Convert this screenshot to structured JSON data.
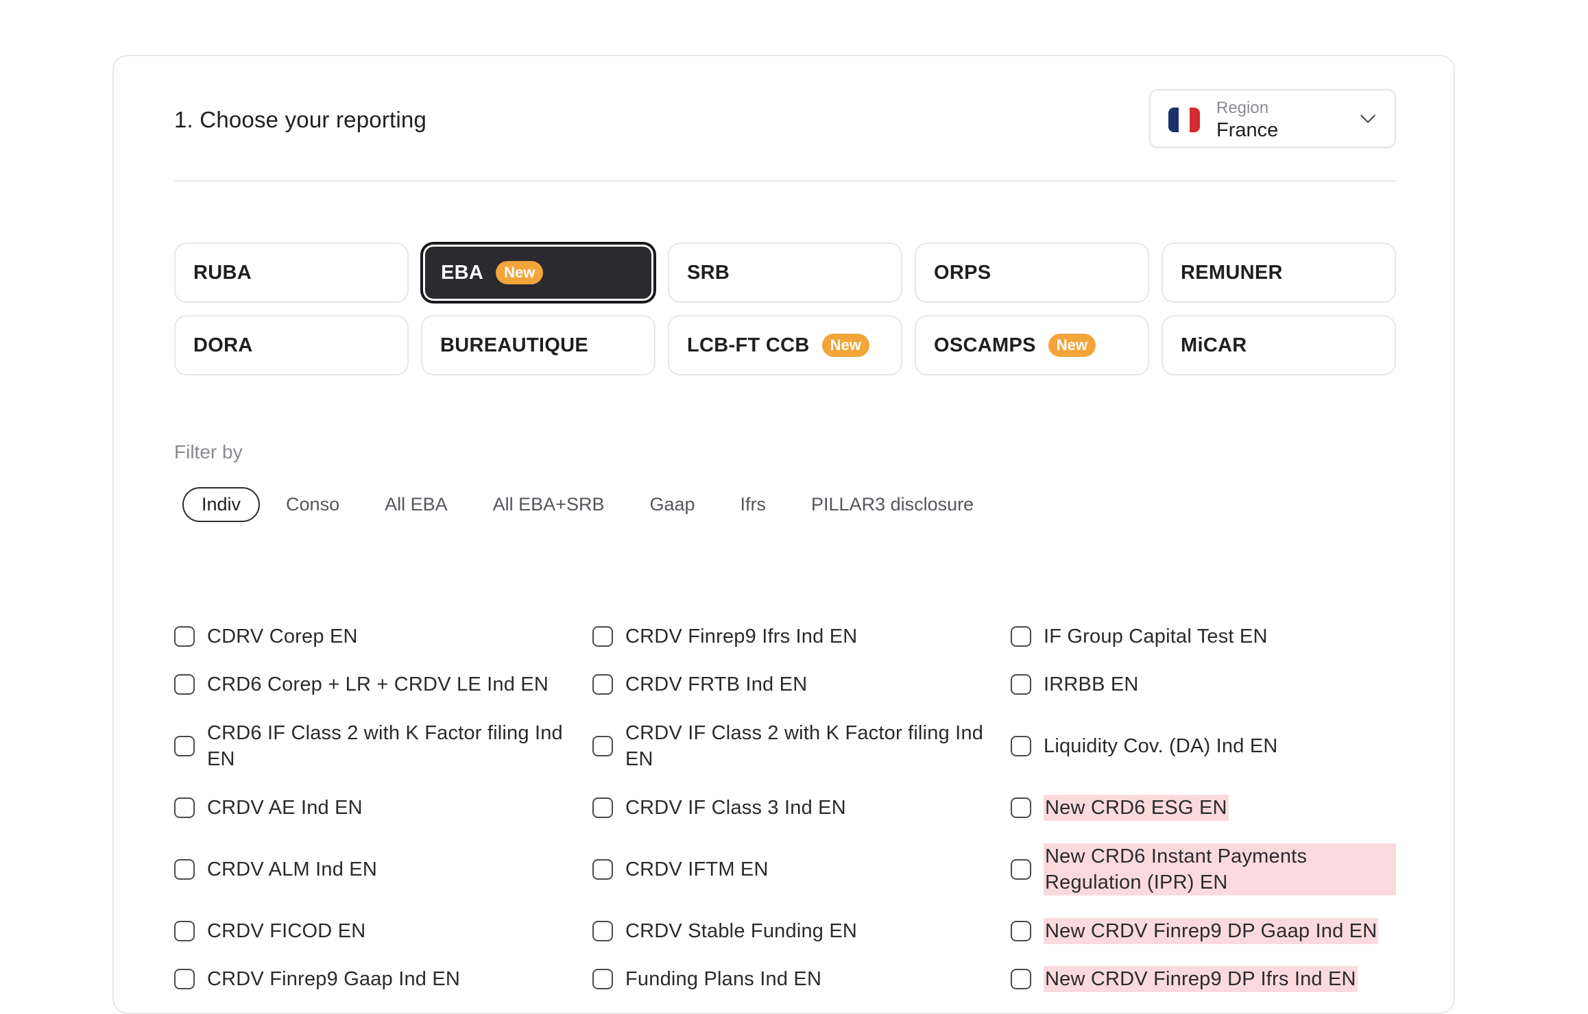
{
  "header": {
    "title": "1. Choose your reporting",
    "region": {
      "label": "Region",
      "value": "France",
      "flag_colors": [
        "#1f2f6b",
        "#ffffff",
        "#d52b2b"
      ]
    }
  },
  "tiles": [
    {
      "label": "RUBA",
      "badge": ""
    },
    {
      "label": "EBA",
      "badge": "New",
      "selected": true
    },
    {
      "label": "SRB",
      "badge": ""
    },
    {
      "label": "ORPS",
      "badge": ""
    },
    {
      "label": "REMUNER",
      "badge": ""
    },
    {
      "label": "DORA",
      "badge": ""
    },
    {
      "label": "BUREAUTIQUE",
      "badge": ""
    },
    {
      "label": "LCB-FT CCB",
      "badge": "New"
    },
    {
      "label": "OSCAMPS",
      "badge": "New"
    },
    {
      "label": "MiCAR",
      "badge": ""
    }
  ],
  "filter": {
    "label": "Filter by",
    "chips": [
      "Indiv",
      "Conso",
      "All EBA",
      "All EBA+SRB",
      "Gaap",
      "Ifrs",
      "PILLAR3 disclosure"
    ],
    "active": "Indiv"
  },
  "options": {
    "col1": [
      "CDRV Corep EN",
      "CRD6 Corep + LR + CRDV LE Ind EN",
      "CRD6 IF Class 2 with K Factor filing Ind EN",
      "CRDV AE Ind EN",
      "CRDV ALM Ind EN",
      "CRDV FICOD EN",
      "CRDV Finrep9 Gaap Ind EN"
    ],
    "col2": [
      "CRDV Finrep9 Ifrs Ind EN",
      "CRDV FRTB Ind EN",
      "CRDV IF Class 2 with K Factor filing Ind EN",
      "CRDV IF Class 3 Ind EN",
      "CRDV IFTM EN",
      "CRDV Stable Funding EN",
      "Funding Plans Ind EN"
    ],
    "col3": [
      "IF Group Capital Test EN",
      "IRRBB EN",
      "Liquidity Cov. (DA) Ind EN",
      "New CRD6 ESG EN",
      "New CRD6 Instant Payments Regulation (IPR) EN",
      "New CRDV Finrep9 DP Gaap Ind EN",
      "New CRDV Finrep9 DP Ifrs Ind EN"
    ],
    "highlight_color": "#fbdadd"
  },
  "colors": {
    "badge": "#f2a53a",
    "selected_tile": "#2b2b2f"
  }
}
